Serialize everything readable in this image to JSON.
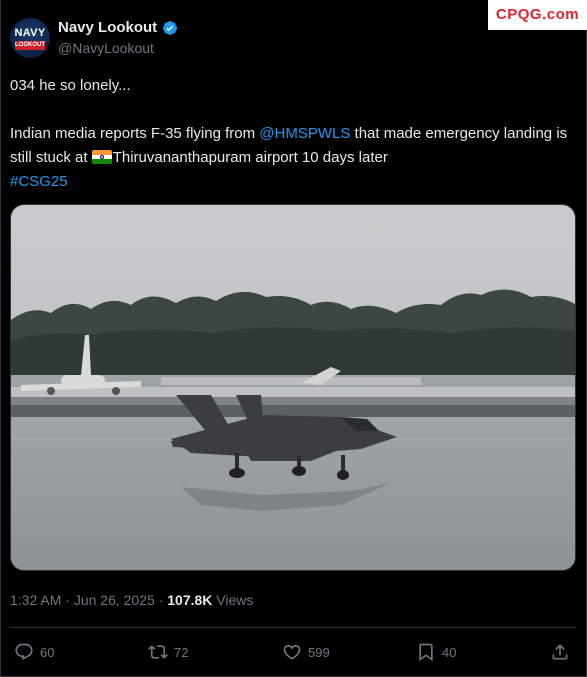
{
  "watermark": "CPQG.com",
  "author": {
    "display_name": "Navy Lookout",
    "handle": "@NavyLookout",
    "avatar_text_top": "NAVY",
    "avatar_text_bottom": "LOOKOUT"
  },
  "tweet": {
    "line1": "034 he so lonely...",
    "line2_pre": "Indian media reports F-35 flying from ",
    "mention": "@HMSPWLS",
    "line2_post": " that made emergency landing is still stuck at ",
    "line2_place": "Thiruvananthapuram airport 10 days later",
    "hashtag": "#CSG25"
  },
  "meta": {
    "time": "1:32 AM",
    "sep": " · ",
    "date": "Jun 26, 2025",
    "views_count": "107.8K",
    "views_label": "Views"
  },
  "actions": {
    "replies": "60",
    "reposts": "72",
    "likes": "599",
    "bookmarks": "40"
  },
  "colors": {
    "accent": "#1d9bf0",
    "background": "#000000",
    "text": "#e7e9ea",
    "muted": "#71767b",
    "watermark": "#e0242d"
  }
}
